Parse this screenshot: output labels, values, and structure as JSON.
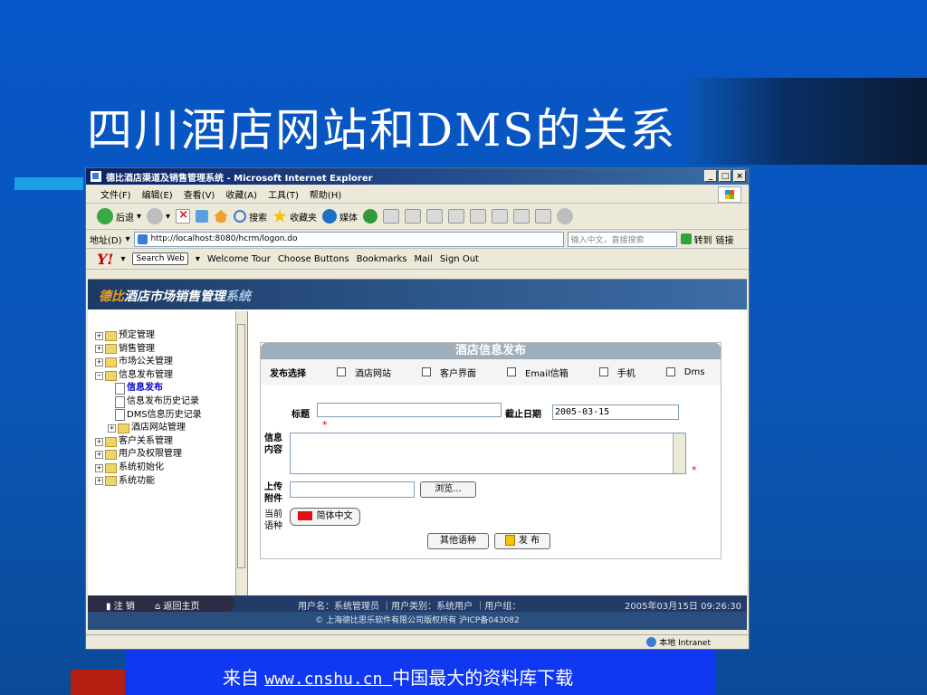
{
  "slide": {
    "title": "四川酒店网站和DMS的关系",
    "footer_prefix": "来自 ",
    "footer_url": "www.cnshu.cn ",
    "footer_suffix": "中国最大的资料库下载"
  },
  "browser": {
    "window_title": "德比酒店渠道及销售管理系统 - Microsoft Internet Explorer",
    "win_buttons": [
      "_",
      "□",
      "×"
    ],
    "menu": [
      "文件(F)",
      "编辑(E)",
      "查看(V)",
      "收藏(A)",
      "工具(T)",
      "帮助(H)"
    ],
    "toolbar": {
      "back": "后退",
      "search": "搜索",
      "favorites": "收藏夹",
      "media": "媒体"
    },
    "address_label": "地址(D)",
    "address_url": "http://localhost:8080/hcrm/logon.do",
    "search_placeholder": "输入中文，直接搜索",
    "go_label": "转到",
    "links_label": "链接",
    "yahoo": {
      "logo": "Y!",
      "search_web": "Search Web",
      "welcome_tour": "Welcome Tour",
      "choose_buttons": "Choose Buttons",
      "bookmarks": "Bookmarks",
      "mail": "Mail",
      "sign_out": "Sign Out"
    },
    "status_zone": "本地 Intranet"
  },
  "app": {
    "brand": "德比",
    "title_main": "酒店市场销售管理",
    "title_suffix": "系统",
    "tree": [
      {
        "label": "预定管理",
        "level": 0,
        "expanded": false
      },
      {
        "label": "销售管理",
        "level": 0,
        "expanded": false
      },
      {
        "label": "市场公关管理",
        "level": 0,
        "expanded": false
      },
      {
        "label": "信息发布管理",
        "level": 0,
        "expanded": true
      },
      {
        "label": "信息发布",
        "level": 1,
        "active": true
      },
      {
        "label": "信息发布历史记录",
        "level": 1
      },
      {
        "label": "DMS信息历史记录",
        "level": 1
      },
      {
        "label": "酒店网站管理",
        "level": 1,
        "folder": true
      },
      {
        "label": "客户关系管理",
        "level": 0,
        "expanded": false
      },
      {
        "label": "用户及权限管理",
        "level": 0,
        "expanded": false
      },
      {
        "label": "系统初始化",
        "level": 0,
        "expanded": false
      },
      {
        "label": "系统功能",
        "level": 0,
        "expanded": false
      }
    ],
    "panel_title": "酒店信息发布",
    "publish_label": "发布选择",
    "publish_options": [
      {
        "label": "酒店网站",
        "checked": false
      },
      {
        "label": "客户界面",
        "checked": false
      },
      {
        "label": "Email信箱",
        "checked": false
      },
      {
        "label": "手机",
        "checked": false
      },
      {
        "label": "Dms",
        "checked": false
      }
    ],
    "title_label": "标题",
    "title_value": "",
    "deadline_label": "截止日期",
    "deadline_value": "2005-03-15",
    "content_label_1": "信息",
    "content_label_2": "内容",
    "attach_label_1": "上传",
    "attach_label_2": "附件",
    "browse_label": "浏览...",
    "lang_label_1": "当前",
    "lang_label_2": "语种",
    "lang_value": "简体中文",
    "other_lang_button": "其他语种",
    "publish_button": "发 布",
    "required_mark": "*",
    "logout": "注 销",
    "home": "返回主页",
    "user_info": "用户名：系统管理员 ｜用户类别：系统用户 ｜用户组：",
    "datetime": "2005年03月15日 09:26:30",
    "copyright": "© 上海德比思乐软件有限公司版权所有 沪ICP备043082"
  }
}
